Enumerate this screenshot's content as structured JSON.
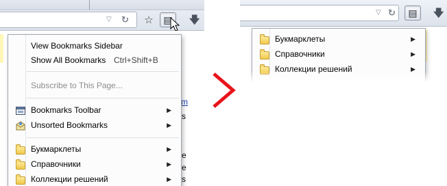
{
  "left": {
    "menu": {
      "top_items": [
        {
          "label": "View Bookmarks Sidebar",
          "accel": ""
        },
        {
          "label": "Show All Bookmarks",
          "accel": "Ctrl+Shift+B"
        }
      ],
      "subscribe_label": "Subscribe to This Page...",
      "toolbar_items": [
        {
          "label": "Bookmarks Toolbar",
          "icon": "bookmarks-toolbar-icon"
        },
        {
          "label": "Unsorted Bookmarks",
          "icon": "unsorted-bookmarks-icon"
        }
      ],
      "folders": [
        {
          "label": "Букмарклеты"
        },
        {
          "label": "Справочники"
        },
        {
          "label": "Коллекции решений"
        }
      ]
    },
    "page_fragments": [
      "m",
      "s",
      "e",
      "e",
      "s"
    ]
  },
  "right": {
    "menu": {
      "folders": [
        {
          "label": "Букмарклеты"
        },
        {
          "label": "Справочники"
        },
        {
          "label": "Коллекции решений"
        }
      ]
    }
  },
  "colors": {
    "chevron": "#e8141b",
    "menu_bg": "#fcfcfc",
    "folder": "#f1c94a",
    "page_highlight": "#fff6b8"
  },
  "icons": {
    "bookmark_star": "star-icon",
    "bookmarks_menu": "clipboard-icon",
    "reload": "reload-icon",
    "download": "download-arrow-icon"
  }
}
